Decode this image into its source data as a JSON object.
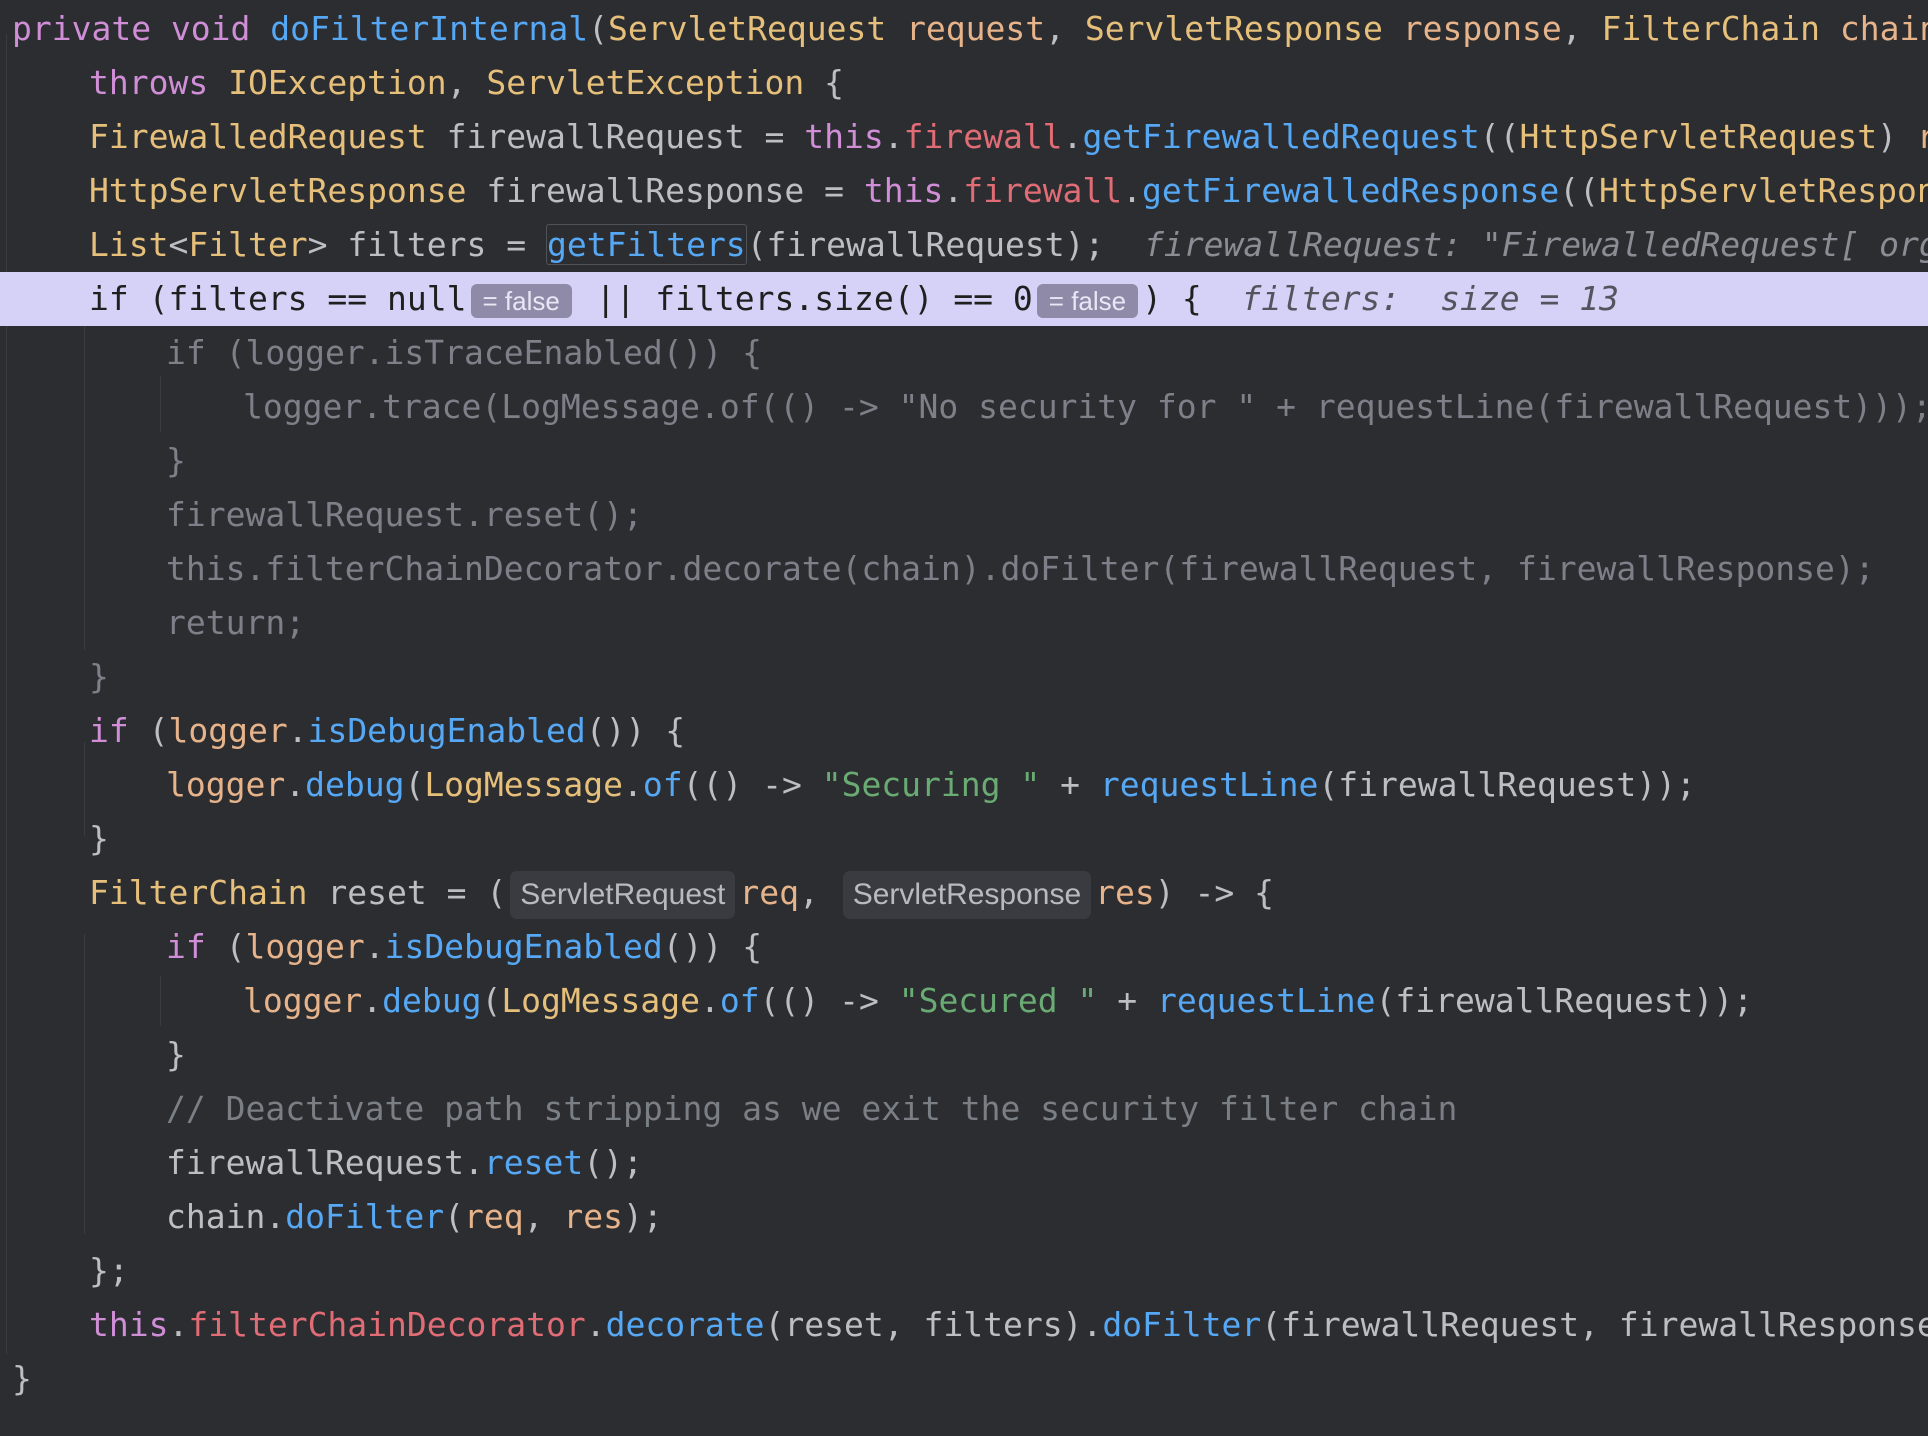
{
  "editor": {
    "language": "java",
    "current_line_index": 5,
    "colors": {
      "background": "#2b2d31",
      "current_line": "#d6d2f7",
      "keyword": "#cf8ed6",
      "function": "#56a8f5",
      "type": "#e6c07b",
      "parameter": "#e6b38a",
      "string": "#6aab73",
      "comment": "#7a7e85"
    },
    "lines": [
      {
        "indent": 0,
        "tokens": [
          {
            "t": "private void ",
            "c": "kw"
          },
          {
            "t": "doFilterInternal",
            "c": "fn"
          },
          {
            "t": "(",
            "c": ""
          },
          {
            "t": "ServletRequest ",
            "c": "ty"
          },
          {
            "t": "request",
            "c": "pm"
          },
          {
            "t": ", ",
            "c": ""
          },
          {
            "t": "ServletResponse ",
            "c": "ty"
          },
          {
            "t": "response",
            "c": "pm"
          },
          {
            "t": ", ",
            "c": ""
          },
          {
            "t": "FilterChain ",
            "c": "ty"
          },
          {
            "t": "chain",
            "c": "pm"
          },
          {
            "t": ")",
            "c": ""
          }
        ]
      },
      {
        "indent": 1,
        "tokens": [
          {
            "t": "throws ",
            "c": "kw"
          },
          {
            "t": "IOException",
            "c": "ty"
          },
          {
            "t": ", ",
            "c": ""
          },
          {
            "t": "ServletException",
            "c": "ty"
          },
          {
            "t": " {",
            "c": ""
          }
        ]
      },
      {
        "indent": 1,
        "tokens": [
          {
            "t": "FirewalledRequest ",
            "c": "ty"
          },
          {
            "t": "firewallRequest = ",
            "c": ""
          },
          {
            "t": "this",
            "c": "kw"
          },
          {
            "t": ".",
            "c": ""
          },
          {
            "t": "firewall",
            "c": "fdr"
          },
          {
            "t": ".",
            "c": ""
          },
          {
            "t": "getFirewalledRequest",
            "c": "fn"
          },
          {
            "t": "((",
            "c": ""
          },
          {
            "t": "HttpServletRequest",
            "c": "ty"
          },
          {
            "t": ") ",
            "c": ""
          },
          {
            "t": "requ",
            "c": "pm"
          }
        ]
      },
      {
        "indent": 1,
        "tokens": [
          {
            "t": "HttpServletResponse ",
            "c": "ty"
          },
          {
            "t": "firewallResponse = ",
            "c": ""
          },
          {
            "t": "this",
            "c": "kw"
          },
          {
            "t": ".",
            "c": ""
          },
          {
            "t": "firewall",
            "c": "fdr"
          },
          {
            "t": ".",
            "c": ""
          },
          {
            "t": "getFirewalledResponse",
            "c": "fn"
          },
          {
            "t": "((",
            "c": ""
          },
          {
            "t": "HttpServletResponse",
            "c": "ty"
          },
          {
            "t": ")",
            "c": ""
          }
        ]
      },
      {
        "indent": 1,
        "tokens": [
          {
            "t": "List",
            "c": "ty"
          },
          {
            "t": "<",
            "c": ""
          },
          {
            "t": "Filter",
            "c": "ty"
          },
          {
            "t": "> filters = ",
            "c": ""
          },
          {
            "t": "getFilters",
            "c": "fn",
            "box": true
          },
          {
            "t": "(firewallRequest);",
            "c": ""
          },
          {
            "t": "  firewallRequest: \"FirewalledRequest[ org.ap",
            "c": "inl"
          }
        ]
      },
      {
        "indent": 1,
        "tokens": [
          {
            "t": "if (filters == null",
            "c": ""
          },
          {
            "t": "= false",
            "c": "eval"
          },
          {
            "t": " || filters.size() == 0",
            "c": ""
          },
          {
            "t": "= false",
            "c": "eval"
          },
          {
            "t": ") {",
            "c": ""
          },
          {
            "t": "  filters:  size = 13",
            "c": "inl"
          }
        ]
      },
      {
        "indent": 2,
        "tokens": [
          {
            "t": "if (logger.isTraceEnabled()) {",
            "c": "gray"
          }
        ]
      },
      {
        "indent": 3,
        "tokens": [
          {
            "t": "logger.trace(LogMessage.of(() -> \"No security for \" + requestLine(firewallRequest)));",
            "c": "gray"
          }
        ]
      },
      {
        "indent": 2,
        "tokens": [
          {
            "t": "}",
            "c": "gray"
          }
        ]
      },
      {
        "indent": 2,
        "tokens": [
          {
            "t": "firewallRequest.reset();",
            "c": "gray"
          }
        ]
      },
      {
        "indent": 2,
        "tokens": [
          {
            "t": "this.filterChainDecorator.decorate(chain).doFilter(firewallRequest, firewallResponse);",
            "c": "gray"
          }
        ]
      },
      {
        "indent": 2,
        "tokens": [
          {
            "t": "return;",
            "c": "gray"
          }
        ]
      },
      {
        "indent": 1,
        "tokens": [
          {
            "t": "}",
            "c": "gray"
          }
        ]
      },
      {
        "indent": 1,
        "tokens": [
          {
            "t": "if ",
            "c": "kw"
          },
          {
            "t": "(",
            "c": ""
          },
          {
            "t": "logger",
            "c": "pm"
          },
          {
            "t": ".",
            "c": ""
          },
          {
            "t": "isDebugEnabled",
            "c": "fn"
          },
          {
            "t": "()) {",
            "c": ""
          }
        ]
      },
      {
        "indent": 2,
        "tokens": [
          {
            "t": "logger",
            "c": "pm"
          },
          {
            "t": ".",
            "c": ""
          },
          {
            "t": "debug",
            "c": "fn"
          },
          {
            "t": "(",
            "c": ""
          },
          {
            "t": "LogMessage",
            "c": "ty"
          },
          {
            "t": ".",
            "c": ""
          },
          {
            "t": "of",
            "c": "fn"
          },
          {
            "t": "(() -> ",
            "c": ""
          },
          {
            "t": "\"Securing \"",
            "c": "st"
          },
          {
            "t": " + ",
            "c": ""
          },
          {
            "t": "requestLine",
            "c": "fn"
          },
          {
            "t": "(firewallRequest));",
            "c": ""
          }
        ]
      },
      {
        "indent": 1,
        "tokens": [
          {
            "t": "}",
            "c": ""
          }
        ]
      },
      {
        "indent": 1,
        "tokens": [
          {
            "t": "FilterChain ",
            "c": "ty"
          },
          {
            "t": "reset = (",
            "c": ""
          },
          {
            "t": "ServletRequest",
            "c": "pill"
          },
          {
            "t": "req",
            "c": "pm"
          },
          {
            "t": ", ",
            "c": ""
          },
          {
            "t": "ServletResponse",
            "c": "pill"
          },
          {
            "t": "res",
            "c": "pm"
          },
          {
            "t": ") -> {",
            "c": ""
          }
        ]
      },
      {
        "indent": 2,
        "tokens": [
          {
            "t": "if ",
            "c": "kw"
          },
          {
            "t": "(",
            "c": ""
          },
          {
            "t": "logger",
            "c": "pm"
          },
          {
            "t": ".",
            "c": ""
          },
          {
            "t": "isDebugEnabled",
            "c": "fn"
          },
          {
            "t": "()) {",
            "c": ""
          }
        ]
      },
      {
        "indent": 3,
        "tokens": [
          {
            "t": "logger",
            "c": "pm"
          },
          {
            "t": ".",
            "c": ""
          },
          {
            "t": "debug",
            "c": "fn"
          },
          {
            "t": "(",
            "c": ""
          },
          {
            "t": "LogMessage",
            "c": "ty"
          },
          {
            "t": ".",
            "c": ""
          },
          {
            "t": "of",
            "c": "fn"
          },
          {
            "t": "(() -> ",
            "c": ""
          },
          {
            "t": "\"Secured \"",
            "c": "st"
          },
          {
            "t": " + ",
            "c": ""
          },
          {
            "t": "requestLine",
            "c": "fn"
          },
          {
            "t": "(firewallRequest));",
            "c": ""
          }
        ]
      },
      {
        "indent": 2,
        "tokens": [
          {
            "t": "}",
            "c": ""
          }
        ]
      },
      {
        "indent": 2,
        "tokens": [
          {
            "t": "// Deactivate path stripping as we exit the security filter chain",
            "c": "cm"
          }
        ]
      },
      {
        "indent": 2,
        "tokens": [
          {
            "t": "firewallRequest.",
            "c": ""
          },
          {
            "t": "reset",
            "c": "fn"
          },
          {
            "t": "();",
            "c": ""
          }
        ]
      },
      {
        "indent": 2,
        "tokens": [
          {
            "t": "chain.",
            "c": ""
          },
          {
            "t": "doFilter",
            "c": "fn"
          },
          {
            "t": "(",
            "c": ""
          },
          {
            "t": "req",
            "c": "pm"
          },
          {
            "t": ", ",
            "c": ""
          },
          {
            "t": "res",
            "c": "pm"
          },
          {
            "t": ");",
            "c": ""
          }
        ]
      },
      {
        "indent": 1,
        "tokens": [
          {
            "t": "};",
            "c": ""
          }
        ]
      },
      {
        "indent": 1,
        "tokens": [
          {
            "t": "this",
            "c": "kw"
          },
          {
            "t": ".",
            "c": ""
          },
          {
            "t": "filterChainDecorator",
            "c": "fdr"
          },
          {
            "t": ".",
            "c": ""
          },
          {
            "t": "decorate",
            "c": "fn"
          },
          {
            "t": "(reset, filters).",
            "c": ""
          },
          {
            "t": "doFilter",
            "c": "fn"
          },
          {
            "t": "(firewallRequest, firewallResponse);",
            "c": ""
          }
        ]
      },
      {
        "indent": 0,
        "tokens": [
          {
            "t": "}",
            "c": ""
          }
        ]
      }
    ]
  }
}
